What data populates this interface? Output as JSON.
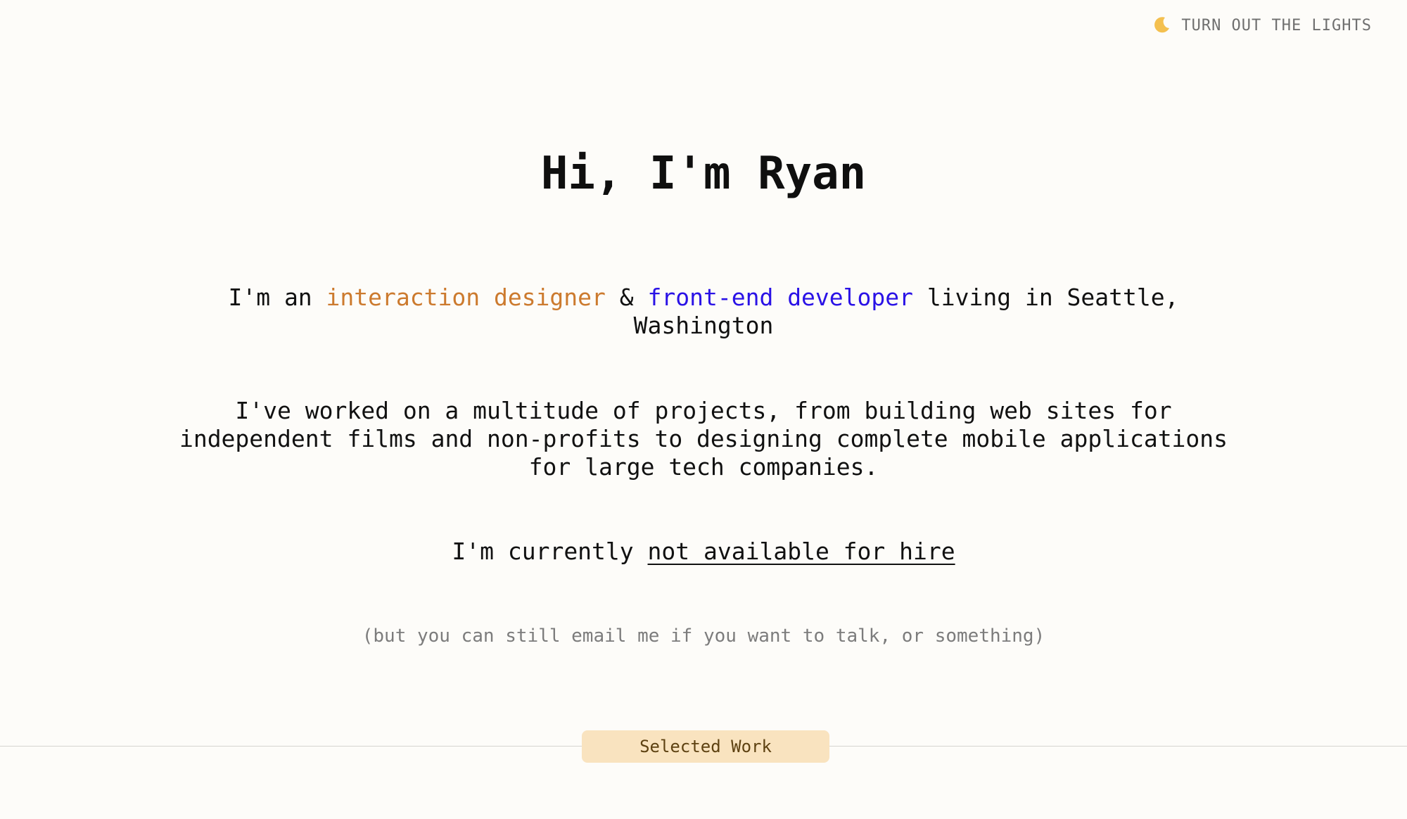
{
  "header": {
    "theme_toggle_icon": "moon-icon",
    "theme_toggle_label": "TURN OUT THE LIGHTS"
  },
  "hero": {
    "title": "Hi, I'm Ryan",
    "intro_prefix": "I'm an ",
    "role_1": "interaction designer",
    "role_joiner": " & ",
    "role_2": "front-end developer",
    "intro_suffix": " living in Seattle, Washington",
    "projects": "I've worked on a multitude of projects, from building web sites for independent films and non-profits to designing complete mobile applications for large tech companies.",
    "hire_prefix": "I'm currently ",
    "hire_status_link": "not available for hire",
    "email_note": "(but you can still email me if you want to talk, or something)"
  },
  "section": {
    "selected_work_label": "Selected Work"
  },
  "colors": {
    "background": "#fdfcf9",
    "designer_accent": "#cc7a2e",
    "developer_accent": "#2a12e6",
    "tab_background": "#f9e3bf",
    "muted_text": "#7c7c7c"
  }
}
